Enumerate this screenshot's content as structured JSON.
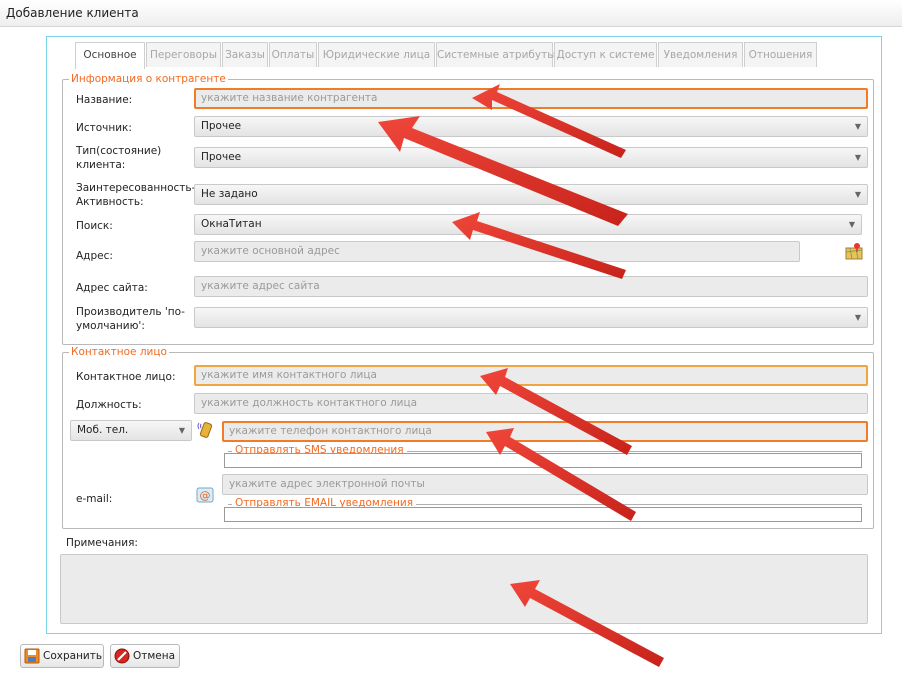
{
  "window": {
    "title": "Добавление клиента"
  },
  "tabs": [
    {
      "label": "Основное",
      "active": true
    },
    {
      "label": "Переговоры"
    },
    {
      "label": "Заказы"
    },
    {
      "label": "Оплаты"
    },
    {
      "label": "Юридические лица"
    },
    {
      "label": "Системные атрибуты"
    },
    {
      "label": "Доступ к системе"
    },
    {
      "label": "Уведомления"
    },
    {
      "label": "Отношения"
    }
  ],
  "counterparty": {
    "legend": "Информация о контрагенте",
    "name_label": "Название:",
    "name_placeholder": "укажите название контрагента",
    "source_label": "Источник:",
    "source_value": "Прочее",
    "type_label": "Тип(состояние) клиента:",
    "type_value": "Прочее",
    "interest_label": "Заинтересованность-Активность:",
    "interest_value": "Не задано",
    "search_label": "Поиск:",
    "search_value": "ОкнаТитан",
    "address_label": "Адрес:",
    "address_placeholder": "укажите основной адрес",
    "site_label": "Адрес сайта:",
    "site_placeholder": "укажите адрес сайта",
    "producer_label": "Производитель 'по-умолчанию':",
    "producer_value": ""
  },
  "contact": {
    "legend": "Контактное лицо",
    "person_label": "Контактное лицо:",
    "person_placeholder": "укажите имя контактного лица",
    "position_label": "Должность:",
    "position_placeholder": "укажите должность контактного лица",
    "phone_type": "Моб. тел.",
    "phone_placeholder": "укажите телефон контактного лица",
    "sms_legend": "Отправлять SMS уведомления",
    "email_label": "e-mail:",
    "email_placeholder": "укажите адрес электронной почты",
    "email_legend": "Отправлять EMAIL уведомления"
  },
  "notes": {
    "label": "Примечания:"
  },
  "buttons": {
    "save": "Сохранить",
    "cancel": "Отмена"
  },
  "colors": {
    "accent": "#f26a21",
    "panel_border": "#7ad3e6",
    "arrow": "#e8392c"
  }
}
